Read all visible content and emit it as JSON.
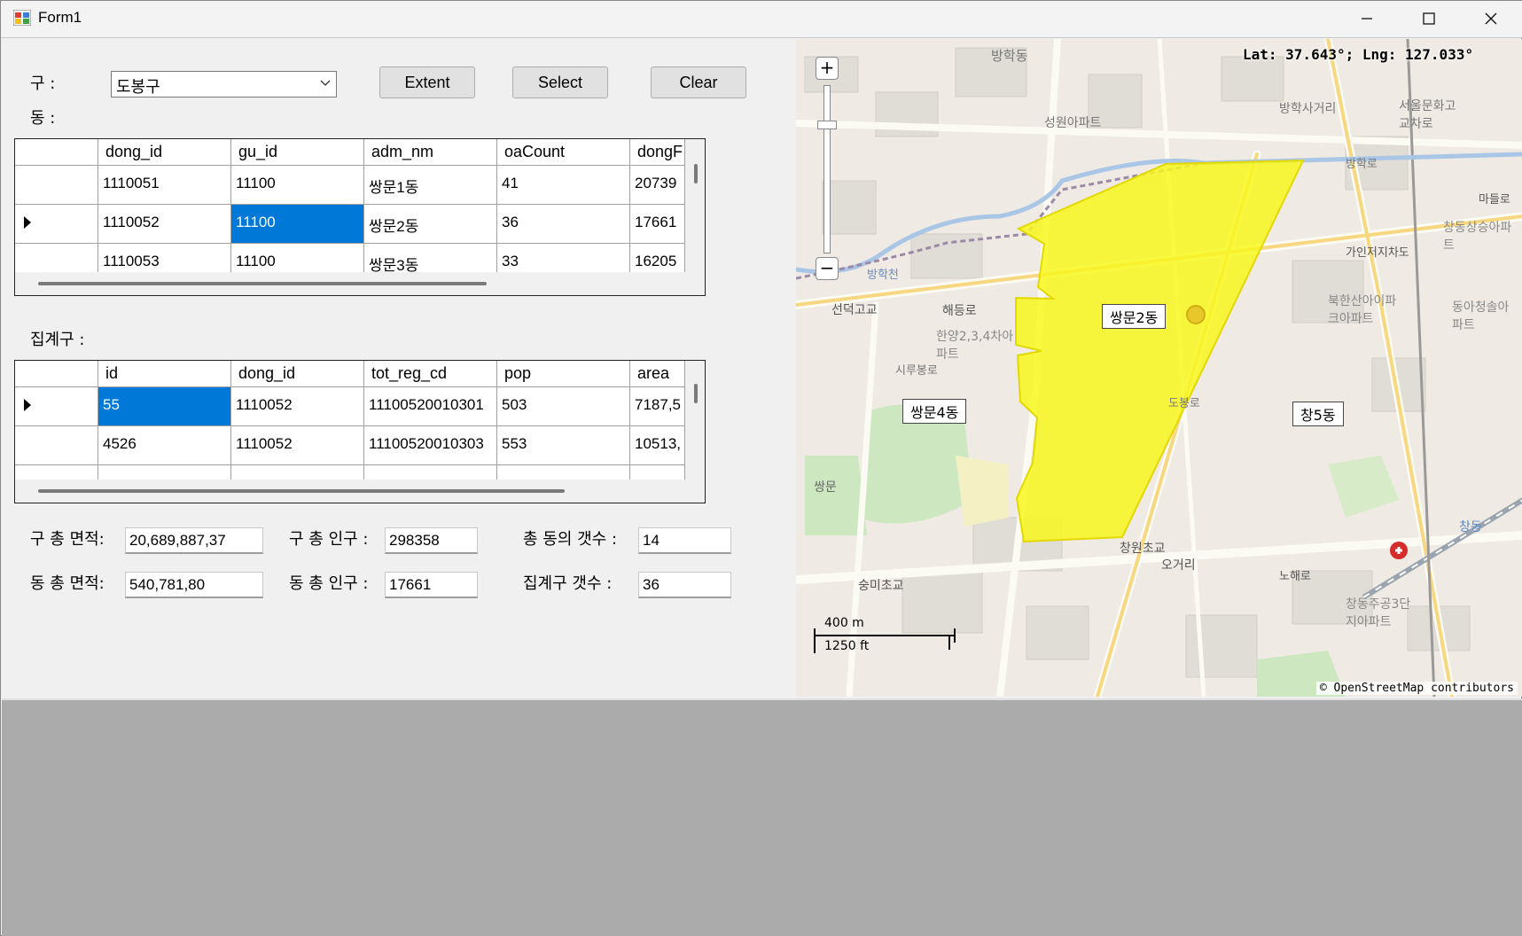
{
  "window": {
    "title": "Form1"
  },
  "labels": {
    "gu": "구 :",
    "dong": "동 :",
    "aggregate": "집계구 :"
  },
  "combo": {
    "value": "도봉구"
  },
  "buttons": {
    "extent": "Extent",
    "select": "Select",
    "clear": "Clear"
  },
  "dong_grid": {
    "columns": [
      "dong_id",
      "gu_id",
      "adm_nm",
      "oaCount",
      "dongF"
    ],
    "rows": [
      [
        "1110051",
        "11100",
        "쌍문1동",
        "41",
        "20739"
      ],
      [
        "1110052",
        "11100",
        "쌍문2동",
        "36",
        "17661"
      ],
      [
        "1110053",
        "11100",
        "쌍문3동",
        "33",
        "16205"
      ]
    ]
  },
  "agg_grid": {
    "columns": [
      "id",
      "dong_id",
      "tot_reg_cd",
      "pop",
      "area"
    ],
    "rows": [
      [
        "55",
        "1110052",
        "11100520010301",
        "503",
        "7187,5"
      ],
      [
        "4526",
        "1110052",
        "11100520010303",
        "553",
        "10513,"
      ]
    ]
  },
  "stats": {
    "gu_area_label": "구 총 면적:",
    "gu_area": "20,689,887,37",
    "gu_pop_label": "구 총 인구 :",
    "gu_pop": "298358",
    "dong_count_label": "총 동의 갯수 :",
    "dong_count": "14",
    "dong_area_label": "동 총 면적:",
    "dong_area": "540,781,80",
    "dong_pop_label": "동 총 인구 :",
    "dong_pop": "17661",
    "agg_count_label": "집계구 갯수 :",
    "agg_count": "36"
  },
  "map": {
    "coords": "Lat: 37.643°; Lng: 127.033°",
    "attribution": "© OpenStreetMap contributors",
    "scale_m": "400 m",
    "scale_ft": "1250 ft",
    "zoom_in": "+",
    "zoom_out": "−",
    "region_labels": [
      "쌍문2동",
      "쌍문4동",
      "창5동"
    ],
    "place_labels": [
      "방학동",
      "성원아파트",
      "방학사거리",
      "서울문화고교차로",
      "선덕고교",
      "해등로",
      "한양2,3,4차아파트",
      "북한산아이파크아파트",
      "창동상승아파트",
      "동아청솔아파트",
      "창원초교",
      "오거리",
      "창동주공3단지아파트",
      "숭미초교",
      "노해로",
      "마들로",
      "방학천",
      "시루봉로",
      "쌍문",
      "창동",
      "가인저지차도",
      "도봉로",
      "방학로"
    ],
    "highlight_color": "#f7f71f"
  }
}
